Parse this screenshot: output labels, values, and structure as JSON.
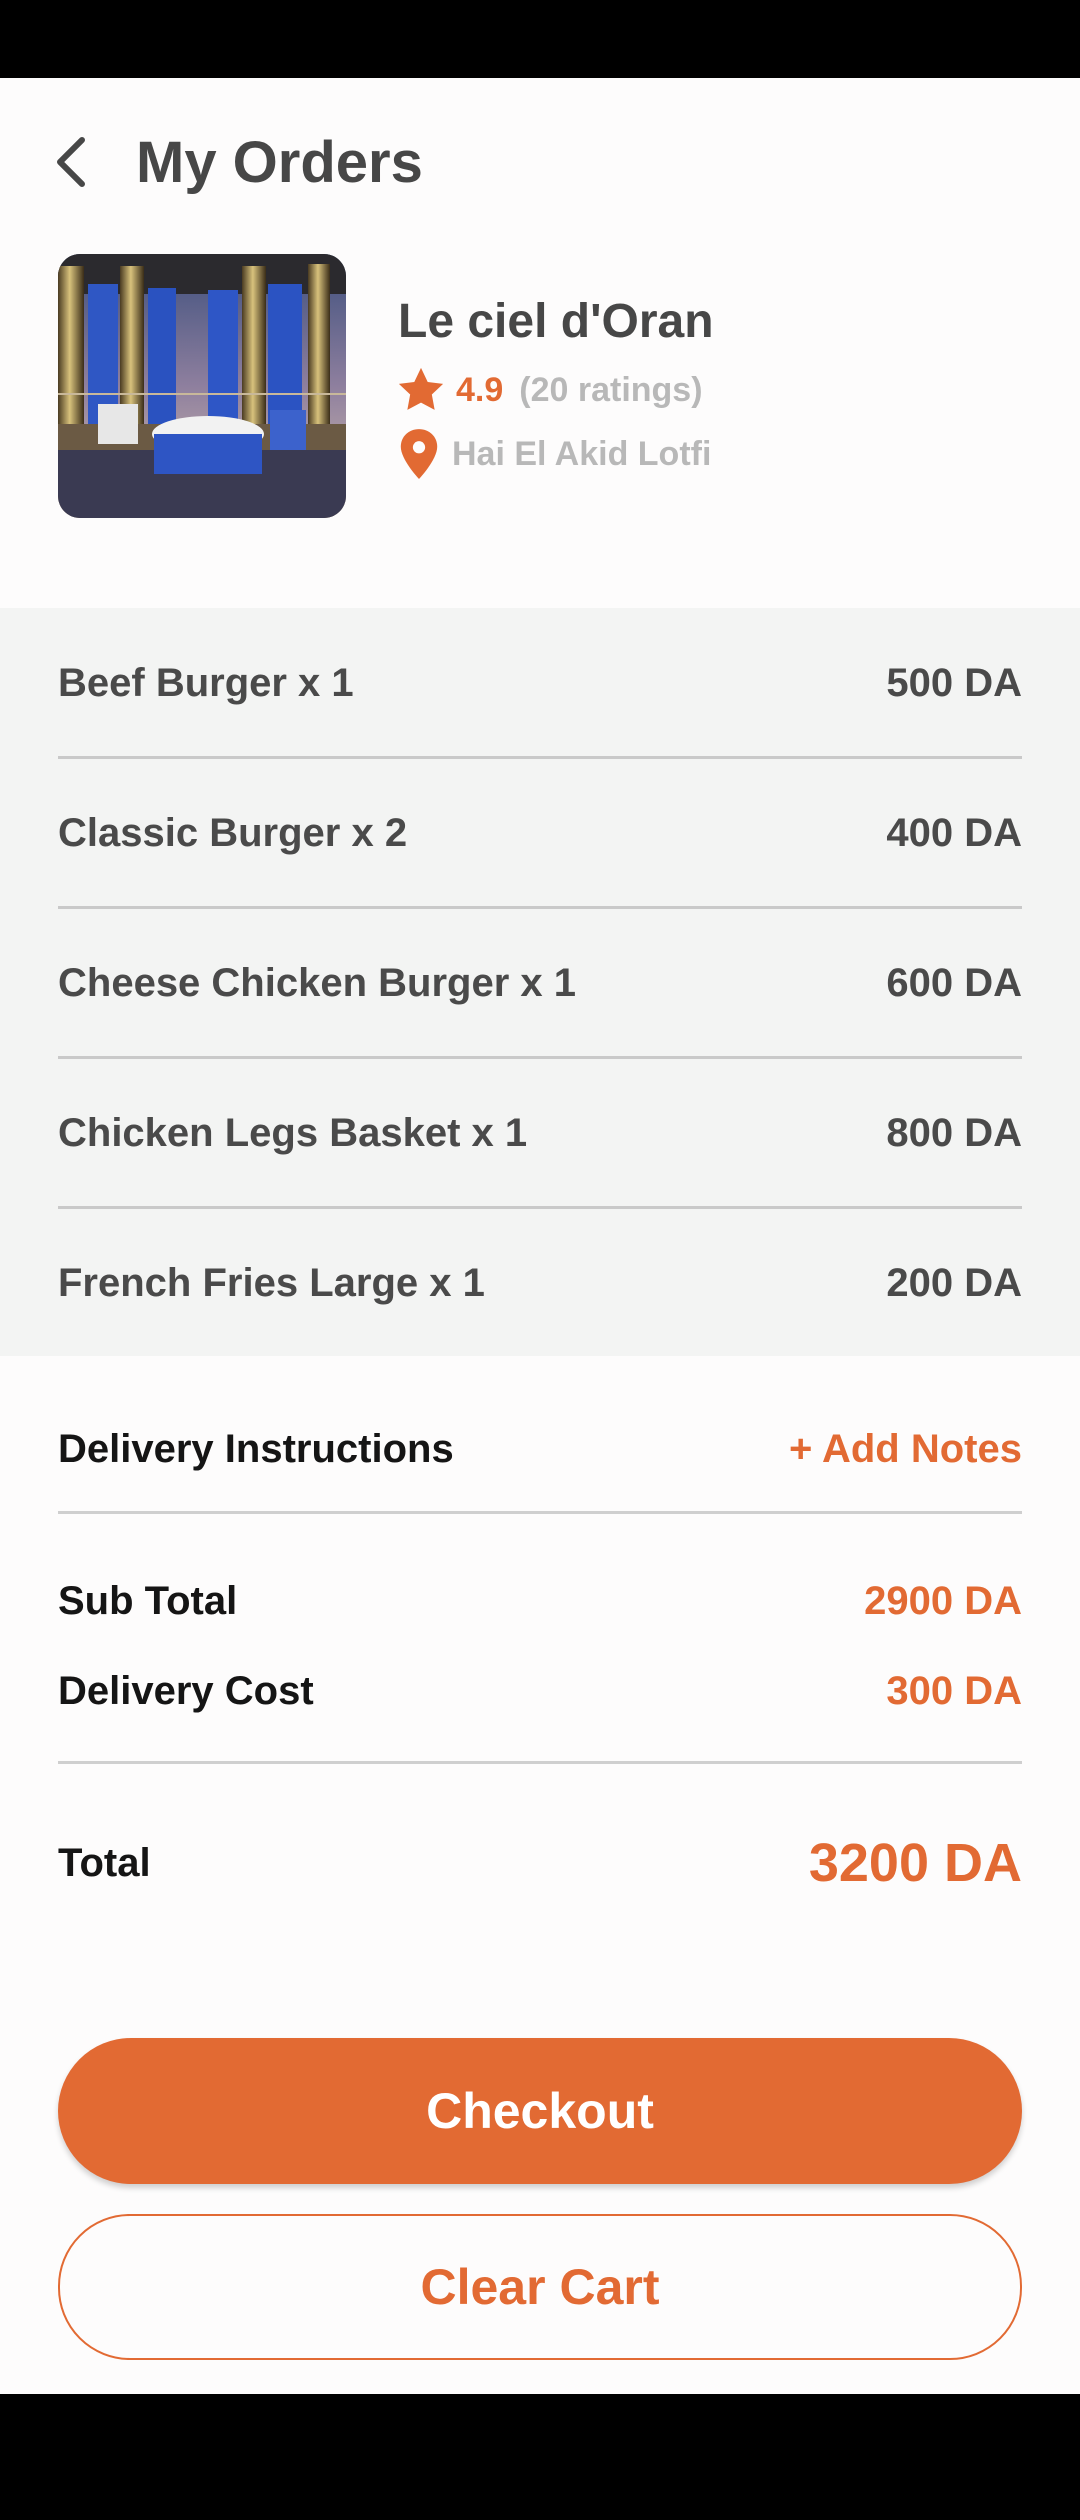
{
  "header": {
    "title": "My Orders",
    "back_icon": "chevron-left-icon"
  },
  "restaurant": {
    "name": "Le ciel d'Oran",
    "rating": "4.9",
    "ratings_count": "(20 ratings)",
    "location": "Hai El Akid Lotfi",
    "icons": {
      "rating": "star-icon",
      "location": "map-pin-icon"
    }
  },
  "order_items": [
    {
      "label": "Beef Burger x 1",
      "price": "500 DA"
    },
    {
      "label": "Classic Burger x 2",
      "price": "400 DA"
    },
    {
      "label": "Cheese Chicken Burger x 1",
      "price": "600 DA"
    },
    {
      "label": "Chicken Legs Basket x 1",
      "price": "800 DA"
    },
    {
      "label": "French Fries Large x 1",
      "price": "200 DA"
    }
  ],
  "delivery": {
    "instructions_label": "Delivery Instructions",
    "add_notes_label": "+ Add Notes"
  },
  "summary": {
    "subtotal_label": "Sub Total",
    "subtotal_value": "2900 DA",
    "delivery_cost_label": "Delivery Cost",
    "delivery_cost_value": "300 DA",
    "total_label": "Total",
    "total_value": "3200 DA"
  },
  "actions": {
    "checkout_label": "Checkout",
    "clear_cart_label": "Clear Cart"
  },
  "colors": {
    "accent": "#e26a33",
    "text_dark": "#474747",
    "text_muted": "#b8b8b8",
    "items_background": "#f3f4f3"
  }
}
